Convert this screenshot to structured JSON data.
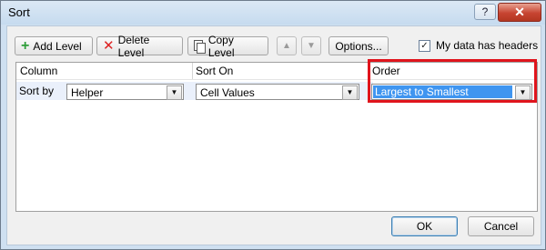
{
  "window": {
    "title": "Sort",
    "help_label": "?",
    "close_label": "✕"
  },
  "toolbar": {
    "add_level": "Add Level",
    "delete_level": "Delete Level",
    "copy_level": "Copy Level",
    "move_up_label": "▲",
    "move_down_label": "▼",
    "options": "Options...",
    "has_headers_label": "My data has headers",
    "has_headers_checked": true
  },
  "grid": {
    "columns": [
      "Column",
      "Sort On",
      "Order"
    ],
    "rows": [
      {
        "label": "Sort by",
        "column": "Helper",
        "sort_on": "Cell Values",
        "order": "Largest to Smallest"
      }
    ]
  },
  "footer": {
    "ok": "OK",
    "cancel": "Cancel"
  },
  "colors": {
    "highlight": "#e0141c",
    "selection": "#3f95f0"
  }
}
